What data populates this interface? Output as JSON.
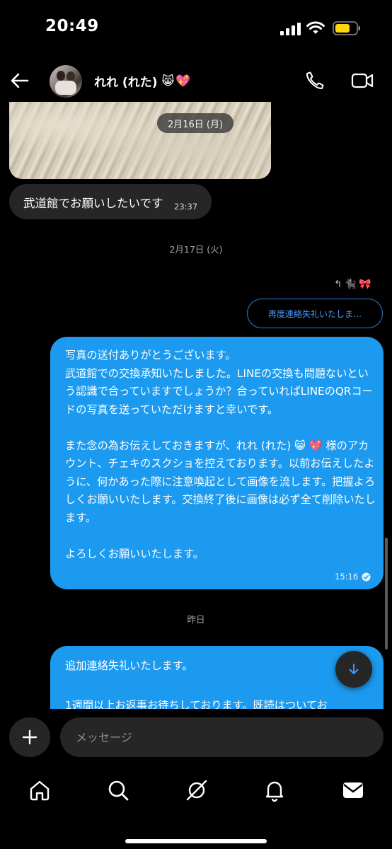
{
  "status_bar": {
    "time": "20:49"
  },
  "header": {
    "name": "れれ (れた)",
    "name_emojis": [
      "😸",
      "💖"
    ]
  },
  "thread": {
    "photo_date": "2月16日 (月)",
    "incoming": [
      {
        "text": "武道館でお願いしたいです",
        "time": "23:37"
      }
    ],
    "date_separator_2": "2月17日 (火)",
    "reply_emojis": [
      "🐈‍⬛",
      "🎀"
    ],
    "reply_preview": "再度連絡失礼いたしま…",
    "outgoing_1": {
      "text": "写真の送付ありがとうございます。\n武道館での交換承知いたしました。LINEの交換も問題ないという認識で合っていますでしょうか？合っていればLINEのQRコードの写真を送っていただけますと幸いです。\n\nまた念の為お伝えしておきますが、れれ (れた) 😸 💖 様のアカウント、チェキのスクショを控えております。以前お伝えしたように、何かあった際に注意喚起として画像を流します。把握よろしくお願いいたします。交換終了後に画像は必ず全て削除いたします。\n\nよろしくお願いいたします。",
      "time": "15:16"
    },
    "date_separator_3": "昨日",
    "outgoing_2": {
      "text": "追加連絡失礼いたします。\n\n1週間以上お返事お待ちしております。既読はついてお"
    }
  },
  "composer": {
    "placeholder": "メッセージ"
  },
  "icons": [
    "back-icon",
    "phone-icon",
    "video-icon",
    "plus-icon",
    "arrow-down-icon",
    "home-icon",
    "search-icon",
    "explore-icon",
    "bell-icon",
    "messages-icon"
  ],
  "colors": {
    "bubble_out": "#1c9aef",
    "bubble_in": "#262626",
    "link": "#4a9bff"
  }
}
